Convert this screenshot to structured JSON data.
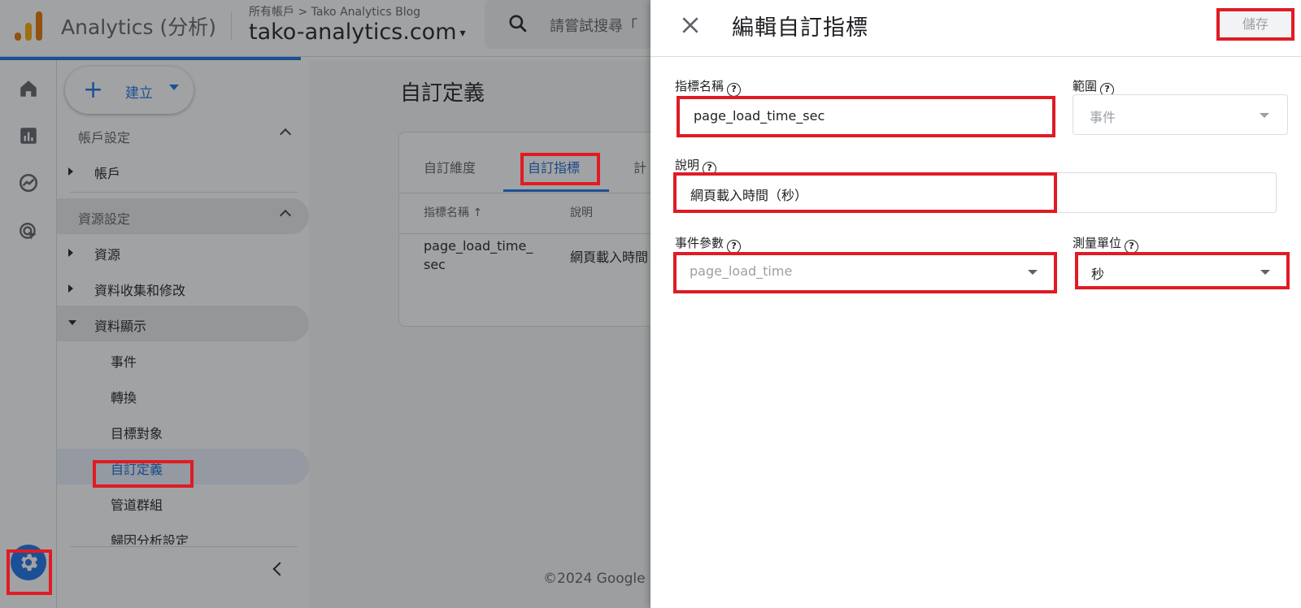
{
  "topbar": {
    "brand": "Analytics (分析)",
    "breadcrumb": "所有帳戶 > Tako Analytics Blog",
    "account": "tako-analytics.com",
    "search_placeholder": "請嘗試搜尋「"
  },
  "sidebar": {
    "create_label": "建立",
    "sections": [
      {
        "label": "帳戶設定",
        "items": [
          {
            "label": "帳戶"
          }
        ]
      },
      {
        "label": "資源設定",
        "items": [
          {
            "label": "資源"
          },
          {
            "label": "資料收集和修改"
          },
          {
            "label": "資料顯示",
            "children": [
              {
                "label": "事件"
              },
              {
                "label": "轉換"
              },
              {
                "label": "目標對象"
              },
              {
                "label": "自訂定義"
              },
              {
                "label": "管道群組"
              },
              {
                "label": "歸因分析設定"
              }
            ]
          }
        ]
      }
    ]
  },
  "content": {
    "page_title": "自訂定義",
    "tabs": [
      "自訂維度",
      "自訂指標",
      "計"
    ],
    "table_headers": [
      "指標名稱",
      "說明"
    ],
    "rows": [
      {
        "name_line1": "page_load_time_",
        "name_line2": "sec",
        "description": "網頁載入時間"
      }
    ],
    "footer": "©2024 Google |"
  },
  "drawer": {
    "title": "編輯自訂指標",
    "save_label": "儲存",
    "fields": {
      "metric_name": {
        "label": "指標名稱",
        "value": "page_load_time_sec"
      },
      "scope": {
        "label": "範圍",
        "value": "事件"
      },
      "description": {
        "label": "說明",
        "value": "網頁載入時間（秒）"
      },
      "event_parameter": {
        "label": "事件參數",
        "value": "page_load_time"
      },
      "unit": {
        "label": "測量單位",
        "value": "秒"
      }
    }
  },
  "colors": {
    "accent": "#1a73e8",
    "highlight": "#e01b24"
  }
}
